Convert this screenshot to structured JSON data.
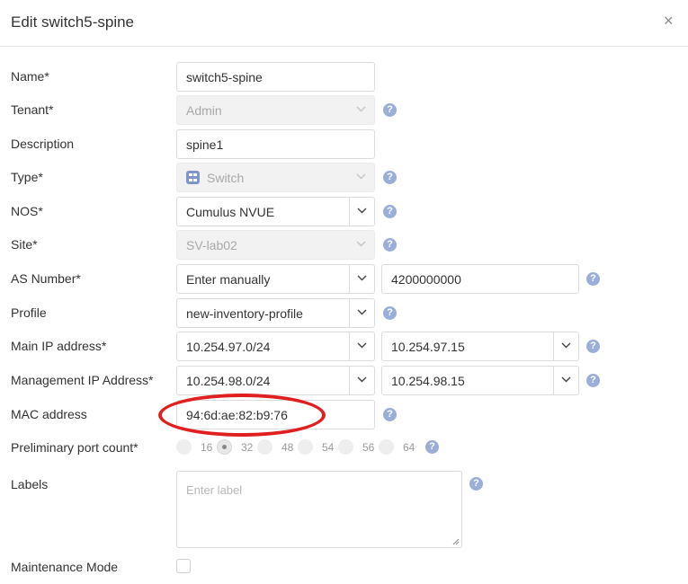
{
  "dialog": {
    "title": "Edit switch5-spine",
    "close_glyph": "×"
  },
  "labels": {
    "name": "Name*",
    "tenant": "Tenant*",
    "description": "Description",
    "type": "Type*",
    "nos": "NOS*",
    "site": "Site*",
    "as_number": "AS Number*",
    "profile": "Profile",
    "main_ip": "Main IP address*",
    "mgmt_ip": "Management IP Address*",
    "mac": "MAC address",
    "port_count": "Preliminary port count*",
    "labels": "Labels",
    "maintenance": "Maintenance Mode"
  },
  "values": {
    "name": "switch5-spine",
    "tenant": "Admin",
    "description": "spine1",
    "type": "Switch",
    "nos": "Cumulus NVUE",
    "site": "SV-lab02",
    "as_mode": "Enter manually",
    "as_number": "4200000000",
    "profile": "new-inventory-profile",
    "main_ip_subnet": "10.254.97.0/24",
    "main_ip": "10.254.97.15",
    "mgmt_ip_subnet": "10.254.98.0/24",
    "mgmt_ip": "10.254.98.15",
    "mac": "94:6d:ae:82:b9:76",
    "labels_placeholder": "Enter label",
    "maintenance_mode": false
  },
  "port_count": {
    "options": [
      "16",
      "32",
      "48",
      "54",
      "56",
      "64"
    ],
    "selected": "32"
  },
  "help_glyph": "?",
  "colors": {
    "help_icon": "#9aaed8",
    "highlight": "#e02020",
    "type_icon": "#7f94c8"
  }
}
